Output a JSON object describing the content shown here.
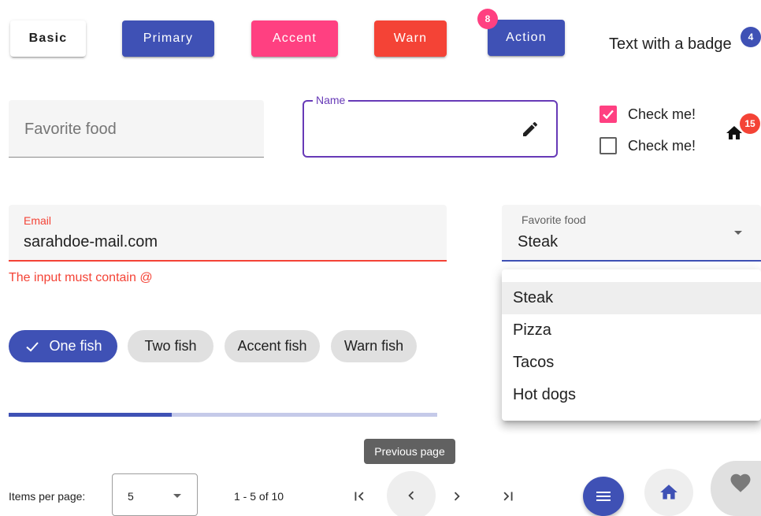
{
  "buttons": {
    "basic": "Basic",
    "primary": "Primary",
    "accent": "Accent",
    "warn": "Warn",
    "action": "Action",
    "action_badge": "8"
  },
  "text_badge": {
    "text": "Text with a badge",
    "count": "4"
  },
  "favorite_food_input": {
    "placeholder": "Favorite food"
  },
  "name_field": {
    "label": "Name",
    "value": ""
  },
  "checkboxes": [
    {
      "label": "Check me!",
      "checked": true
    },
    {
      "label": "Check me!",
      "checked": false
    }
  ],
  "home_badge": {
    "count": "15"
  },
  "email_field": {
    "label": "Email",
    "value": "sarahdoe-mail.com",
    "error": "The input must contain @"
  },
  "food_select": {
    "label": "Favorite food",
    "value": "Steak",
    "options": [
      "Steak",
      "Pizza",
      "Tacos",
      "Hot dogs"
    ]
  },
  "chips": [
    {
      "label": "One fish",
      "selected": true
    },
    {
      "label": "Two fish",
      "selected": false
    },
    {
      "label": "Accent fish",
      "selected": false
    },
    {
      "label": "Warn fish",
      "selected": false
    }
  ],
  "progress": {
    "value_fraction": 0.38
  },
  "paginator": {
    "items_per_page_label": "Items per page:",
    "page_size": "5",
    "range_label": "1 - 5 of 10",
    "tooltip": "Previous page"
  },
  "colors": {
    "primary": "#3f51b5",
    "accent": "#ff4081",
    "warn": "#f44336",
    "outline_focus": "#673ab7",
    "error_text": "#f44336"
  },
  "icons": [
    "pencil-icon",
    "home-icon",
    "check-icon",
    "arrow-drop-down-icon",
    "first-page-icon",
    "chevron-left-icon",
    "chevron-right-icon",
    "last-page-icon",
    "menu-icon",
    "heart-icon"
  ]
}
